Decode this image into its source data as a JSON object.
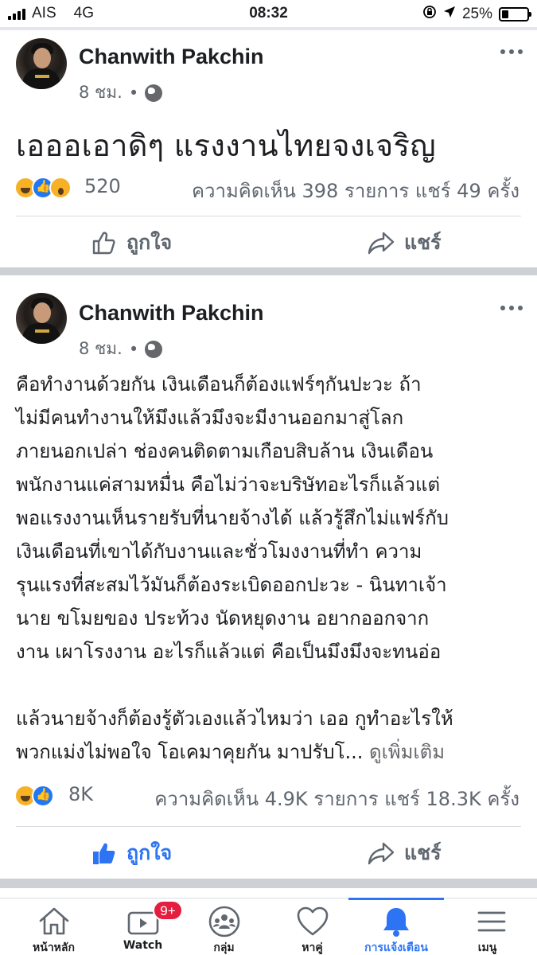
{
  "status_bar": {
    "carrier": "AIS",
    "network": "4G",
    "time": "08:32",
    "battery": "25%",
    "battery_level": 0.25
  },
  "posts": [
    {
      "author": "Chanwith Pakchin",
      "time": "8 ชม.",
      "separator": "•",
      "text_lines": [
        "เอออเอาดิๆ แรงงานไทยจงเจริญ"
      ],
      "reactions": [
        "haha",
        "like",
        "wow"
      ],
      "reaction_count": "520",
      "comments_shares": "ความคิดเห็น 398 รายการ  แชร์ 49 ครั้ง",
      "like_label": "ถูกใจ",
      "share_label": "แชร์",
      "liked": false
    },
    {
      "author": "Chanwith Pakchin",
      "time": "8 ชม.",
      "separator": "•",
      "text_lines": [
        "คือทำงานด้วยกัน เงินเดือนก็ต้องแฟร์ๆกันปะวะ ถ้า",
        "ไม่มีคนทำงานให้มึงแล้วมึงจะมีงานออกมาสู่โลก",
        "ภายนอกเปล่า  ช่องคนติดตามเกือบสิบล้าน เงินเดือน",
        "พนักงานแค่สามหมื่น คือไม่ว่าจะบริษัทอะไรก็แล้วแต่",
        "พอแรงงานเห็นรายรับที่นายจ้างได้ แล้วรู้สึกไม่แฟร์กับ",
        "เงินเดือนที่เขาได้กับงานและชั่วโมงงานที่ทำ ความ",
        "รุนแรงที่สะสมไว้มันก็ต้องระเบิดออกปะวะ - นินทาเจ้า",
        "นาย ขโมยของ ประท้วง นัดหยุดงาน อยากออกจาก",
        "งาน เผาโรงงาน อะไรก็แล้วแต่ คือเป็นมึงมึงจะทนอ่อ",
        "",
        "แล้วนายจ้างก็ต้องรู้ตัวเองแล้วไหมว่า เออ กูทำอะไรให้",
        "พวกแม่งไม่พอใจ โอเคมาคุยกัน มาปรับโ..."
      ],
      "see_more": "ดูเพิ่มเติม",
      "reactions": [
        "haha",
        "like"
      ],
      "reaction_count": "8K",
      "comments_shares": "ความคิดเห็น 4.9K รายการ  แชร์ 18.3K ครั้ง",
      "like_label": "ถูกใจ",
      "share_label": "แชร์",
      "liked": true
    }
  ],
  "bottom_nav": [
    {
      "label": "หน้าหลัก",
      "icon": "home-icon"
    },
    {
      "label": "Watch",
      "icon": "watch-icon",
      "badge": "9+"
    },
    {
      "label": "กลุ่ม",
      "icon": "groups-icon"
    },
    {
      "label": "หาคู่",
      "icon": "dating-heart-icon"
    },
    {
      "label": "การแจ้งเตือน",
      "icon": "bell-icon",
      "active": true
    },
    {
      "label": "เมนู",
      "icon": "menu-icon"
    }
  ],
  "colors": {
    "accent": "#2d74f4",
    "muted": "#606770",
    "divider": "#cdd0d5",
    "badge": "#e41e3f"
  }
}
